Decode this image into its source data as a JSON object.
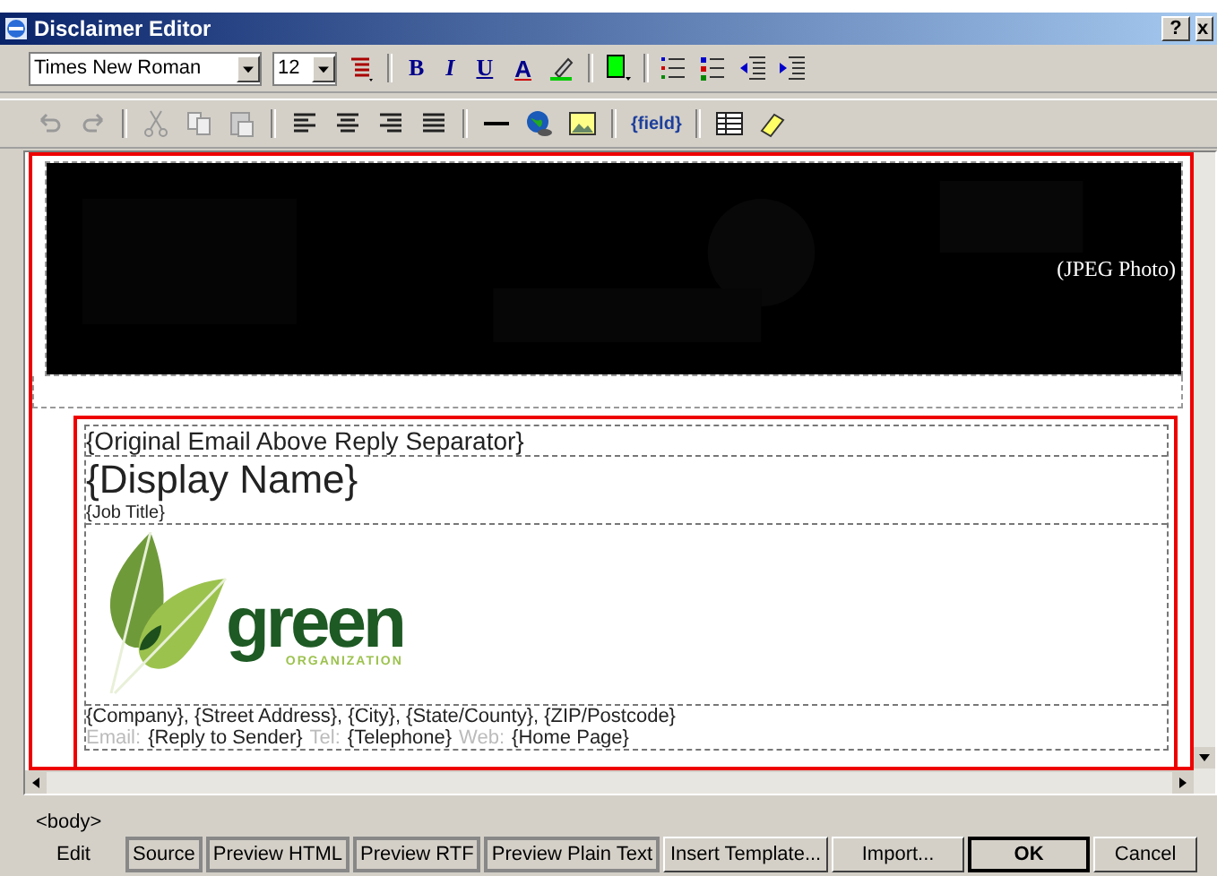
{
  "window": {
    "title": "Disclaimer Editor",
    "help": "?",
    "close": "x"
  },
  "toolbar": {
    "font": "Times New Roman",
    "size": "12",
    "bold": "B",
    "italic": "I",
    "underline": "U",
    "text_color": "A",
    "field": "{field}"
  },
  "photo": {
    "label": "(JPEG Photo)"
  },
  "signature": {
    "separator": "{Original Email Above Reply Separator}",
    "name": "{Display Name}",
    "job": "{Job Title}",
    "logo": {
      "word": "green",
      "sub": "ORGANIZATION"
    },
    "address": "{Company}, {Street Address}, {City}, {State/County}, {ZIP/Postcode}",
    "contacts": [
      {
        "kind": "label",
        "text": "Email:"
      },
      {
        "kind": "value",
        "text": "{Reply to Sender}"
      },
      {
        "kind": "label",
        "text": "Tel:"
      },
      {
        "kind": "value",
        "text": "{Telephone}"
      },
      {
        "kind": "label",
        "text": "Web:"
      },
      {
        "kind": "value",
        "text": "{Home Page}"
      }
    ]
  },
  "status_bar": {
    "path": "<body>"
  },
  "tabs": [
    {
      "label": "Edit",
      "selected": true
    },
    {
      "label": "Source",
      "selected": false
    },
    {
      "label": "Preview HTML",
      "selected": false
    },
    {
      "label": "Preview RTF",
      "selected": false
    },
    {
      "label": "Preview Plain Text",
      "selected": false
    }
  ],
  "buttons": [
    {
      "label": "Insert Template...",
      "kind": "normal"
    },
    {
      "label": "Import...",
      "kind": "normal"
    },
    {
      "label": "OK",
      "kind": "default"
    },
    {
      "label": "Cancel",
      "kind": "normal"
    }
  ]
}
